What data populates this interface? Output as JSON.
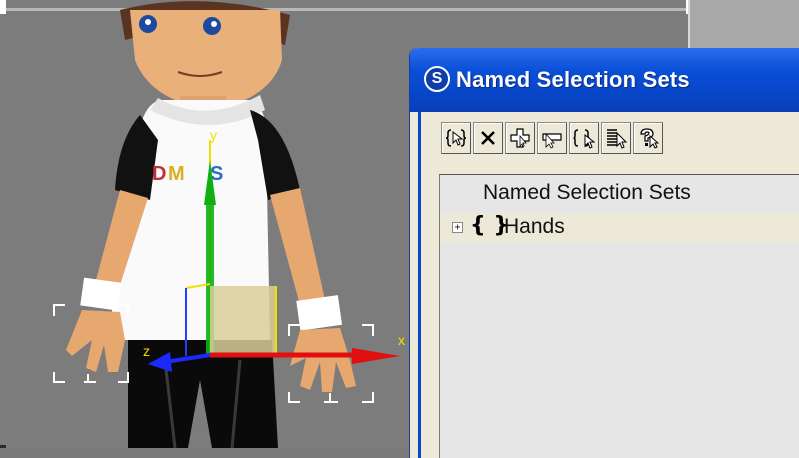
{
  "dialog": {
    "title": "Named Selection Sets",
    "toolbar": [
      {
        "name": "create-set-button",
        "icon": "braces-cursor-icon"
      },
      {
        "name": "delete-button",
        "icon": "x-icon"
      },
      {
        "name": "add-selected-button",
        "icon": "plus-icon"
      },
      {
        "name": "subtract-selected-button",
        "icon": "minus-icon"
      },
      {
        "name": "select-objects-in-set-button",
        "icon": "braces-select-icon"
      },
      {
        "name": "select-objects-by-name-button",
        "icon": "list-select-icon"
      },
      {
        "name": "highlight-selected-button",
        "icon": "question-select-icon"
      }
    ],
    "list": {
      "header": "Named Selection Sets",
      "rows": [
        {
          "expander": "+",
          "icon": "{ }",
          "label": "Hands"
        }
      ]
    }
  },
  "viewport": {
    "shirt_text": "DMS",
    "gizmo_axes": [
      "x",
      "y",
      "z"
    ]
  }
}
